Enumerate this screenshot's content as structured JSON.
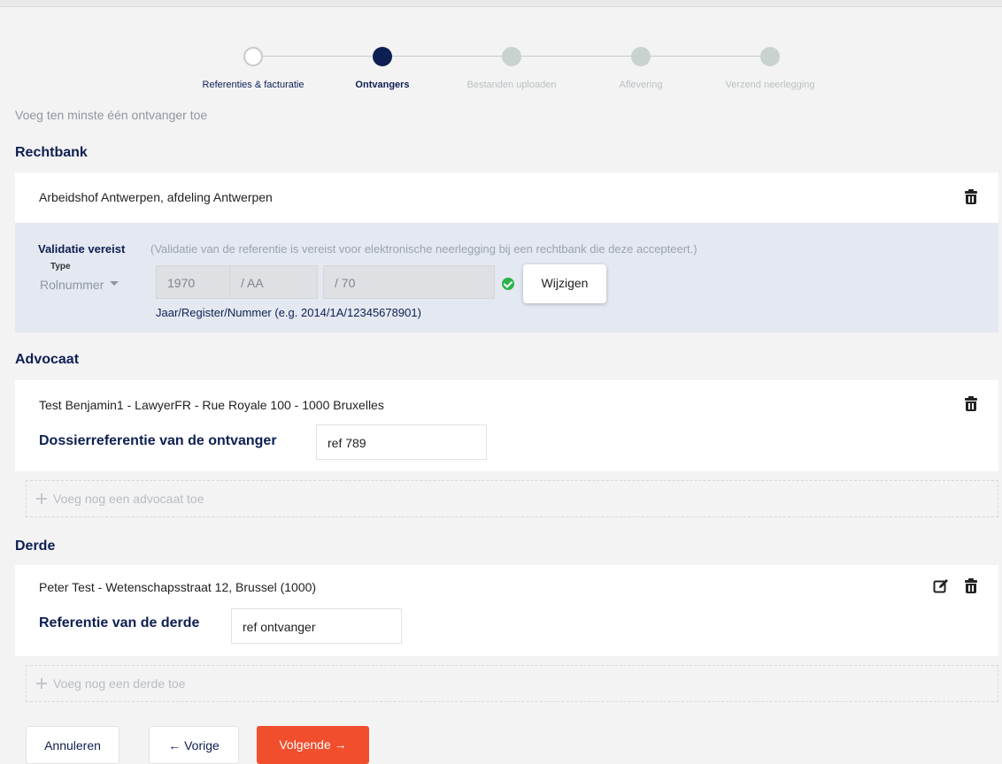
{
  "stepper": {
    "steps": [
      {
        "label": "Referenties & facturatie",
        "state": "done"
      },
      {
        "label": "Ontvangers",
        "state": "active"
      },
      {
        "label": "Bestanden uploaden",
        "state": "todo"
      },
      {
        "label": "Aflevering",
        "state": "todo"
      },
      {
        "label": "Verzend neerlegging",
        "state": "todo"
      }
    ]
  },
  "hint": "Voeg ten minste één ontvanger toe",
  "court": {
    "title": "Rechtbank",
    "name": "Arbeidshof Antwerpen, afdeling Antwerpen",
    "validation": {
      "title": "Validatie vereist",
      "note": "(Validatie van de referentie is vereist voor elektronische neerlegging bij een rechtbank die deze accepteert.)",
      "type_label": "Type",
      "type_value": "Rolnummer",
      "year": "1970",
      "register": "AA",
      "number": "70",
      "help": "Jaar/Register/Nummer (e.g. 2014/1A/12345678901)",
      "change_label": "Wijzigen"
    }
  },
  "lawyer": {
    "title": "Advocaat",
    "name": "Test Benjamin1 - LawyerFR - Rue Royale 100 - 1000 Bruxelles",
    "ref_label": "Dossierreferentie van de ontvanger",
    "ref_value": "ref 789",
    "add_label": "Voeg nog een advocaat toe"
  },
  "third": {
    "title": "Derde",
    "name": "Peter Test - Wetenschapsstraat 12, Brussel (1000)",
    "ref_label": "Referentie van de derde",
    "ref_value": "ref ontvanger",
    "add_label": "Voeg nog een derde toe"
  },
  "footer": {
    "cancel_label": "Annuleren",
    "prev_label": "← Vorige",
    "next_label": "Volgende →"
  },
  "colors": {
    "navy": "#0d1f52",
    "accent": "#f04e2c",
    "success": "#2bb34a"
  }
}
